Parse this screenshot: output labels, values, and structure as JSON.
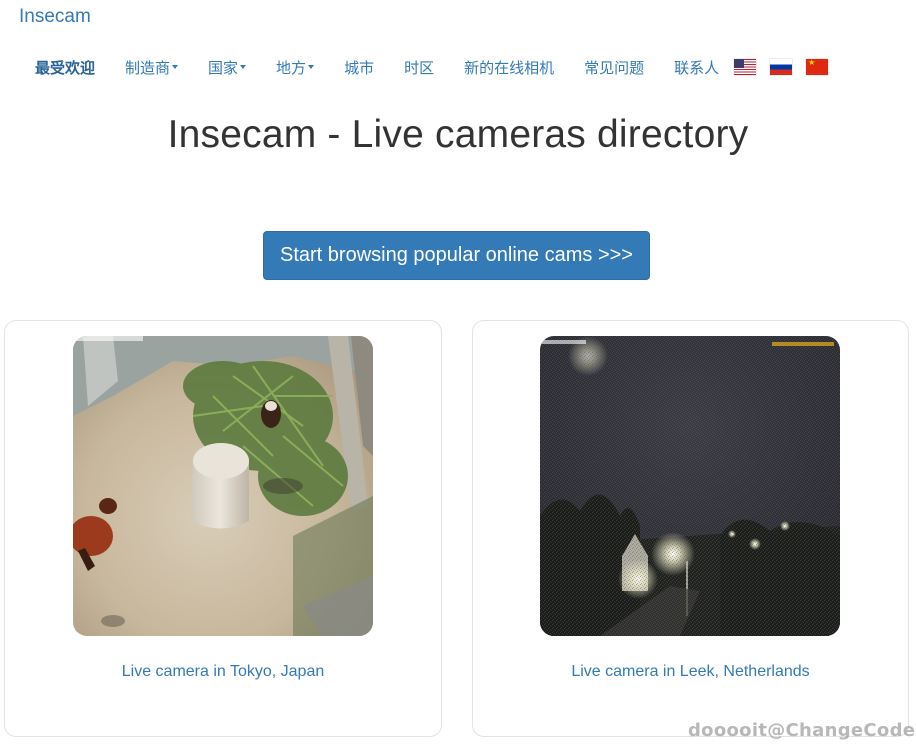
{
  "header": {
    "brand": "Insecam"
  },
  "nav": {
    "items": [
      {
        "label": "最受欢迎",
        "active": true,
        "dropdown": false
      },
      {
        "label": "制造商",
        "active": false,
        "dropdown": true
      },
      {
        "label": "国家",
        "active": false,
        "dropdown": true
      },
      {
        "label": "地方",
        "active": false,
        "dropdown": true
      },
      {
        "label": "城市",
        "active": false,
        "dropdown": false
      },
      {
        "label": "时区",
        "active": false,
        "dropdown": false
      },
      {
        "label": "新的在线相机",
        "active": false,
        "dropdown": false
      },
      {
        "label": "常见问题",
        "active": false,
        "dropdown": false
      },
      {
        "label": "联系人",
        "active": false,
        "dropdown": false
      }
    ],
    "flags": [
      "us-flag-icon",
      "russia-flag-icon",
      "china-flag-icon"
    ]
  },
  "main": {
    "title": "Insecam - Live cameras directory",
    "cta_label": "Start browsing popular online cams >>>"
  },
  "cameras": [
    {
      "caption": "Live camera in Tokyo, Japan"
    },
    {
      "caption": "Live camera in Leek, Netherlands"
    }
  ],
  "watermark": "dooooit@ChangeCode",
  "colors": {
    "link": "#337ab7",
    "button_bg": "#337ab7",
    "title": "#333333"
  }
}
